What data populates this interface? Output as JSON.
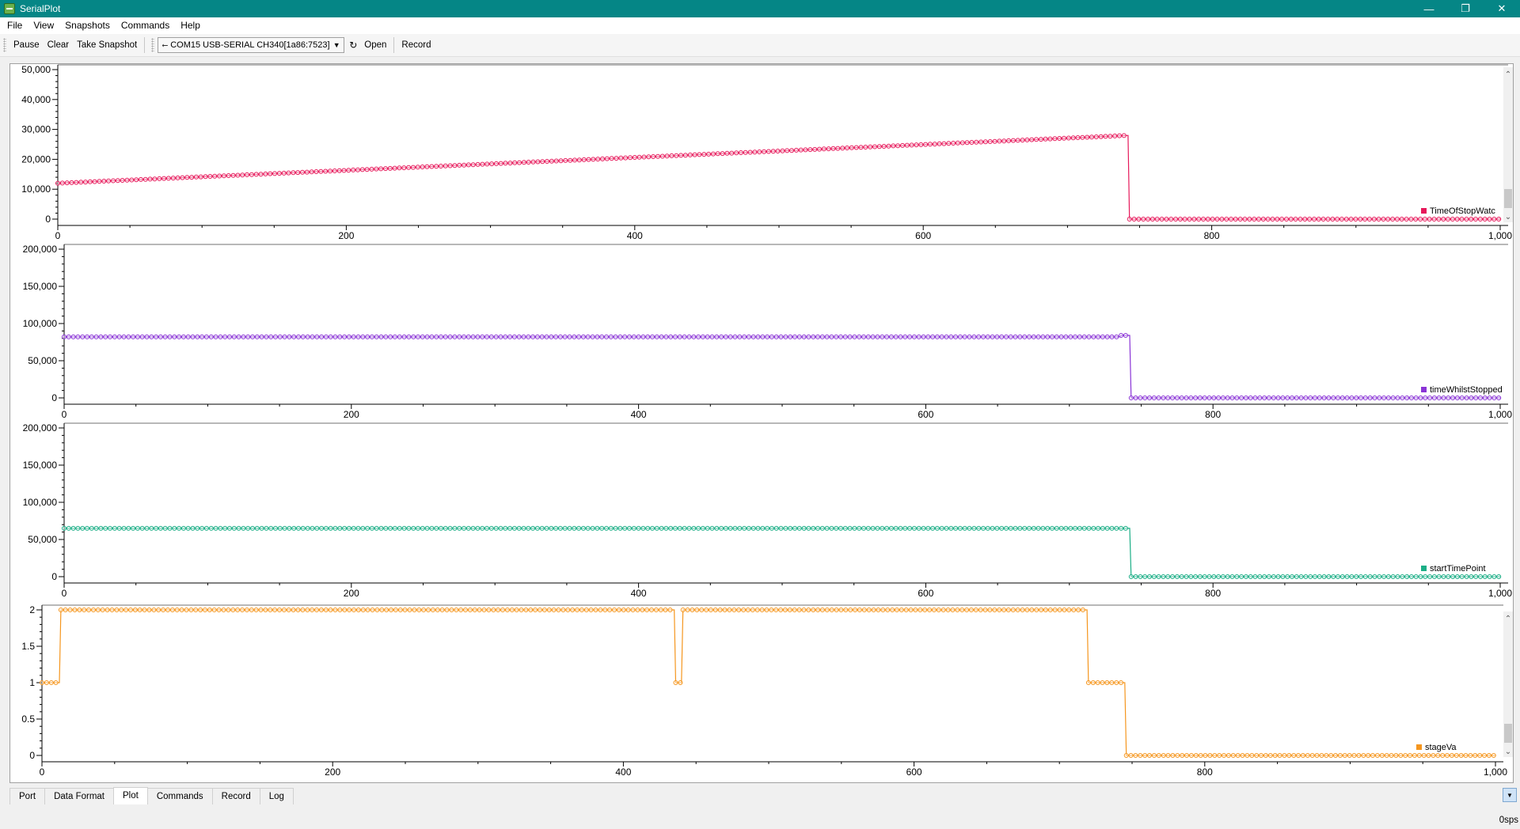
{
  "window": {
    "title": "SerialPlot",
    "minimize": "—",
    "restore": "❐",
    "close": "✕"
  },
  "menu": [
    {
      "label": "File"
    },
    {
      "label": "View"
    },
    {
      "label": "Snapshots"
    },
    {
      "label": "Commands"
    },
    {
      "label": "Help"
    }
  ],
  "toolbar": {
    "pause": "Pause",
    "clear": "Clear",
    "snapshot": "Take Snapshot",
    "port": "COM15 USB-SERIAL CH340[1a86:7523]",
    "open": "Open",
    "record": "Record"
  },
  "tabs": [
    {
      "label": "Port"
    },
    {
      "label": "Data Format"
    },
    {
      "label": "Plot"
    },
    {
      "label": "Commands"
    },
    {
      "label": "Record"
    },
    {
      "label": "Log"
    }
  ],
  "active_tab": "Plot",
  "status": {
    "sps": "0sps"
  },
  "chart_data": [
    {
      "type": "line",
      "series": [
        {
          "name": "TimeOfStopWatch",
          "color": "#e6185a",
          "points": [
            [
              0,
              12000
            ],
            [
              742,
              28000
            ],
            [
              743,
              0
            ],
            [
              1000,
              0
            ]
          ]
        }
      ],
      "xlim": [
        0,
        1000
      ],
      "ylim": [
        0,
        50000
      ],
      "xticks": [
        0,
        200,
        400,
        600,
        800,
        1000
      ],
      "xtick_labels": [
        "0",
        "200",
        "400",
        "600",
        "800",
        "1,000"
      ],
      "yticks": [
        0,
        10000,
        20000,
        30000,
        40000,
        50000
      ],
      "ytick_labels": [
        "0",
        "10,000",
        "20,000",
        "30,000",
        "40,000",
        "50,000"
      ],
      "legend": "bottom-right",
      "legend_label": "TimeOfStopWatc"
    },
    {
      "type": "line",
      "series": [
        {
          "name": "timeWhilstStopped",
          "color": "#8a34d6",
          "points": [
            [
              0,
              82000
            ],
            [
              735,
              82000
            ],
            [
              736,
              84000
            ],
            [
              742,
              84000
            ],
            [
              743,
              0
            ],
            [
              1000,
              0
            ]
          ]
        }
      ],
      "xlim": [
        0,
        1000
      ],
      "ylim": [
        0,
        200000
      ],
      "xticks": [
        0,
        200,
        400,
        600,
        800,
        1000
      ],
      "xtick_labels": [
        "0",
        "200",
        "400",
        "600",
        "800",
        "1,000"
      ],
      "yticks": [
        0,
        50000,
        100000,
        150000,
        200000
      ],
      "ytick_labels": [
        "0",
        "50,000",
        "100,000",
        "150,000",
        "200,000"
      ],
      "legend": "bottom-right",
      "legend_label": "timeWhilstStopped"
    },
    {
      "type": "line",
      "series": [
        {
          "name": "startTimePoint",
          "color": "#1bae86",
          "points": [
            [
              0,
              65000
            ],
            [
              742,
              65000
            ],
            [
              743,
              0
            ],
            [
              1000,
              0
            ]
          ]
        }
      ],
      "xlim": [
        0,
        1000
      ],
      "ylim": [
        0,
        200000
      ],
      "xticks": [
        0,
        200,
        400,
        600,
        800,
        1000
      ],
      "xtick_labels": [
        "0",
        "200",
        "400",
        "600",
        "800",
        "1,000"
      ],
      "yticks": [
        0,
        50000,
        100000,
        150000,
        200000
      ],
      "ytick_labels": [
        "0",
        "50,000",
        "100,000",
        "150,000",
        "200,000"
      ],
      "legend": "bottom-right",
      "legend_label": "startTimePoint"
    },
    {
      "type": "line",
      "series": [
        {
          "name": "stageVa",
          "color": "#f5961e",
          "points": [
            [
              0,
              1
            ],
            [
              12,
              1
            ],
            [
              13,
              2
            ],
            [
              435,
              2
            ],
            [
              436,
              1
            ],
            [
              440,
              1
            ],
            [
              441,
              2
            ],
            [
              719,
              2
            ],
            [
              720,
              1
            ],
            [
              745,
              1
            ],
            [
              746,
              0
            ],
            [
              1000,
              0
            ]
          ]
        }
      ],
      "xlim": [
        0,
        1000
      ],
      "ylim": [
        0,
        2
      ],
      "xticks": [
        0,
        200,
        400,
        600,
        800,
        1000
      ],
      "xtick_labels": [
        "0",
        "200",
        "400",
        "600",
        "800",
        "1,000"
      ],
      "yticks": [
        0,
        0.5,
        1,
        1.5,
        2
      ],
      "ytick_labels": [
        "0",
        "0.5",
        "1",
        "1.5",
        "2"
      ],
      "legend": "bottom-right",
      "legend_label": "stageVa"
    }
  ]
}
